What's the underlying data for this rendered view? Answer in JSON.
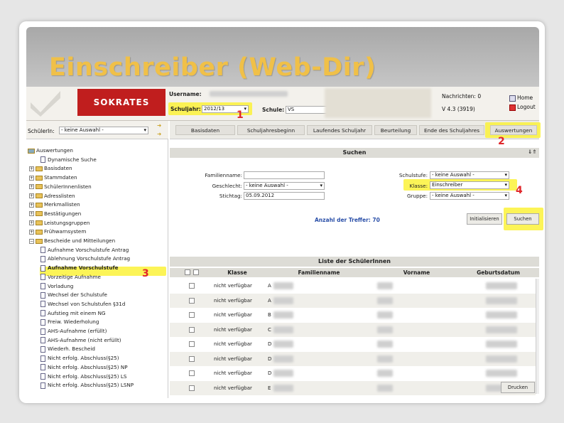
{
  "slide": {
    "title": "Einschreiber (Web-Dir)"
  },
  "header": {
    "logo_text": "SOKRATES",
    "username_label": "Username:",
    "schuljahr_label": "Schuljahr:",
    "schuljahr_value": "2012/13",
    "schule_label": "Schule:",
    "schule_value": "VS",
    "nachrichten": "Nachrichten: 0",
    "version": "V 4.3 (3919)",
    "home": "Home",
    "logout": "Logout"
  },
  "sidebar": {
    "schueler_label": "SchülerIn:",
    "schueler_value": "- keine Auswahl -",
    "tree": [
      {
        "label": "Auswertungen",
        "kind": "root"
      },
      {
        "label": "Dynamische Suche",
        "kind": "item"
      },
      {
        "label": "Basisdaten",
        "kind": "folder"
      },
      {
        "label": "Stammdaten",
        "kind": "folder"
      },
      {
        "label": "SchülerInnenlisten",
        "kind": "folder"
      },
      {
        "label": "Adresslisten",
        "kind": "folder"
      },
      {
        "label": "Merkmallisten",
        "kind": "folder"
      },
      {
        "label": "Bestätigungen",
        "kind": "folder"
      },
      {
        "label": "Leistungsgruppen",
        "kind": "folder"
      },
      {
        "label": "Frühwarnsystem",
        "kind": "folder"
      },
      {
        "label": "Bescheide und Mitteilungen",
        "kind": "folder-open"
      },
      {
        "label": "Aufnahme Vorschulstufe Antrag",
        "kind": "doc"
      },
      {
        "label": "Ablehnung Vorschulstufe Antrag",
        "kind": "doc"
      },
      {
        "label": "Aufnahme Vorschulstufe",
        "kind": "doc",
        "selected": true
      },
      {
        "label": "Vorzeitige Aufnahme",
        "kind": "doc"
      },
      {
        "label": "Vorladung",
        "kind": "doc"
      },
      {
        "label": "Wechsel der Schulstufe",
        "kind": "doc"
      },
      {
        "label": "Wechsel von Schulstufen §31d",
        "kind": "doc"
      },
      {
        "label": "Aufstieg mit einem NG",
        "kind": "doc"
      },
      {
        "label": "Freiw. Wiederholung",
        "kind": "doc"
      },
      {
        "label": "AHS-Aufnahme (erfüllt)",
        "kind": "doc"
      },
      {
        "label": "AHS-Aufnahme (nicht erfüllt)",
        "kind": "doc"
      },
      {
        "label": "Wiederh. Bescheid",
        "kind": "doc"
      },
      {
        "label": "Nicht erfolg. Abschluss(§25)",
        "kind": "doc"
      },
      {
        "label": "Nicht erfolg. Abschluss(§25) NP",
        "kind": "doc"
      },
      {
        "label": "Nicht erfolg. Abschluss(§25) LS",
        "kind": "doc"
      },
      {
        "label": "Nicht erfolg. Abschluss(§25) LSNP",
        "kind": "doc"
      }
    ]
  },
  "tabs": [
    "Basisdaten",
    "Schuljahresbeginn",
    "Laufendes Schuljahr",
    "Beurteilung",
    "Ende des Schuljahres",
    "Auswertungen"
  ],
  "search": {
    "title": "Suchen",
    "familienname_label": "Familienname:",
    "geschlecht_label": "Geschlecht:",
    "geschlecht_value": "- keine Auswahl -",
    "stichtag_label": "Stichtag:",
    "stichtag_value": "05.09.2012",
    "schulstufe_label": "Schulstufe:",
    "schulstufe_value": "- keine Auswahl -",
    "klasse_label": "Klasse:",
    "klasse_value": "Einschreiber",
    "gruppe_label": "Gruppe:",
    "gruppe_value": "- keine Auswahl -",
    "treffer": "Anzahl der Treffer: 70",
    "init_button": "Initialisieren",
    "search_button": "Suchen"
  },
  "list": {
    "title": "Liste der SchülerInnen",
    "columns": [
      "Klasse",
      "Familienname",
      "Vorname",
      "Geburtsdatum"
    ],
    "rows": [
      {
        "klasse": "nicht verfügbar",
        "initial": "A"
      },
      {
        "klasse": "nicht verfügbar",
        "initial": "A"
      },
      {
        "klasse": "nicht verfügbar",
        "initial": "B"
      },
      {
        "klasse": "nicht verfügbar",
        "initial": "C"
      },
      {
        "klasse": "nicht verfügbar",
        "initial": "D"
      },
      {
        "klasse": "nicht verfügbar",
        "initial": "D"
      },
      {
        "klasse": "nicht verfügbar",
        "initial": "D"
      },
      {
        "klasse": "nicht verfügbar",
        "initial": "E"
      }
    ],
    "print_button": "Drucken"
  },
  "annotations": [
    "1",
    "2",
    "3",
    "4"
  ],
  "colors": {
    "highlight": "#fbf23a",
    "annotation": "#e0262a",
    "logo": "#c01e1e",
    "title": "#f0c048"
  }
}
